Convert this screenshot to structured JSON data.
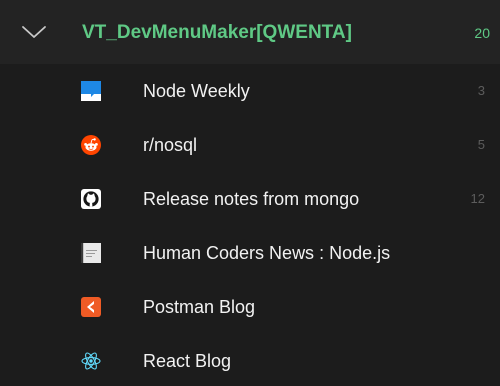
{
  "folder": {
    "title": "VT_DevMenuMaker[QWENTA]",
    "unread_count": "20",
    "expanded": true,
    "accent_color": "#5fc985"
  },
  "feeds": [
    {
      "label": "Node Weekly",
      "unread_count": "3",
      "icon": "node-weekly-icon"
    },
    {
      "label": "r/nosql",
      "unread_count": "5",
      "icon": "reddit-icon"
    },
    {
      "label": "Release notes from mongo",
      "unread_count": "12",
      "icon": "github-icon"
    },
    {
      "label": "Human Coders News : Node.js",
      "unread_count": "",
      "icon": "human-coders-icon"
    },
    {
      "label": "Postman Blog",
      "unread_count": "",
      "icon": "postman-icon"
    },
    {
      "label": "React Blog",
      "unread_count": "",
      "icon": "react-icon"
    }
  ]
}
